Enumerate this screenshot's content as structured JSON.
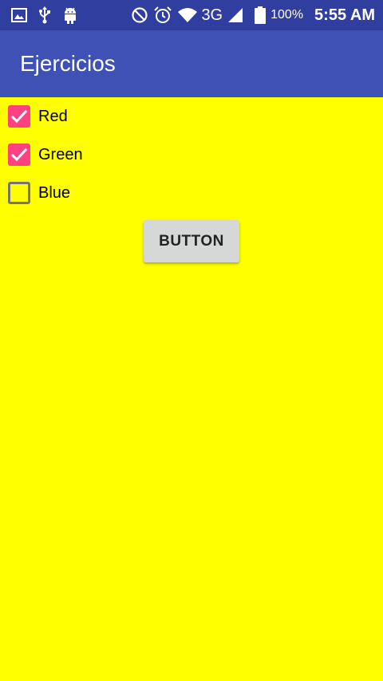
{
  "status_bar": {
    "left_icons": [
      "image-icon",
      "usb-icon",
      "android-icon"
    ],
    "right_icons": [
      "do-not-disturb-icon",
      "alarm-icon",
      "wifi-icon",
      "cell-signal-icon",
      "battery-icon"
    ],
    "network_label": "3G",
    "battery_percent": "100%",
    "time": "5:55 AM",
    "colors": {
      "background": "#303f9f",
      "foreground": "#ffffff"
    }
  },
  "app_bar": {
    "title": "Ejercicios",
    "color": "#3f51b5"
  },
  "content": {
    "background": "#ffff00",
    "checkboxes": [
      {
        "label": "Red",
        "checked": true
      },
      {
        "label": "Green",
        "checked": true
      },
      {
        "label": "Blue",
        "checked": false
      }
    ],
    "checkbox_checked_color": "#ff4081",
    "button": {
      "label": "BUTTON"
    }
  }
}
